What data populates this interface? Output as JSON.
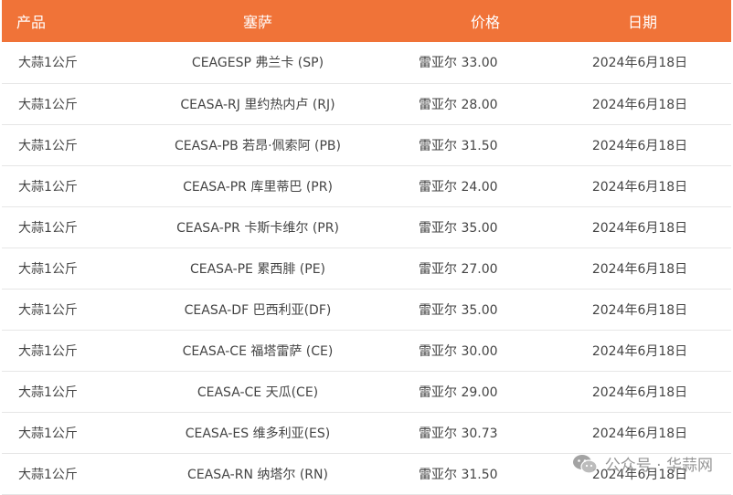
{
  "table": {
    "headers": {
      "product": "产品",
      "ceasa": "塞萨",
      "price": "价格",
      "date": "日期"
    },
    "rows": [
      {
        "product": "大蒜1公斤",
        "ceasa": "CEAGESP 弗兰卡 (SP)",
        "price": "雷亚尔 33.00",
        "date": "2024年6月18日"
      },
      {
        "product": "大蒜1公斤",
        "ceasa": "CEASA-RJ 里约热内卢 (RJ)",
        "price": "雷亚尔 28.00",
        "date": "2024年6月18日"
      },
      {
        "product": "大蒜1公斤",
        "ceasa": "CEASA-PB 若昂·佩索阿 (PB)",
        "price": "雷亚尔 31.50",
        "date": "2024年6月18日"
      },
      {
        "product": "大蒜1公斤",
        "ceasa": "CEASA-PR 库里蒂巴 (PR)",
        "price": "雷亚尔 24.00",
        "date": "2024年6月18日"
      },
      {
        "product": "大蒜1公斤",
        "ceasa": "CEASA-PR 卡斯卡维尔 (PR)",
        "price": "雷亚尔 35.00",
        "date": "2024年6月18日"
      },
      {
        "product": "大蒜1公斤",
        "ceasa": "CEASA-PE 累西腓 (PE)",
        "price": "雷亚尔 27.00",
        "date": "2024年6月18日"
      },
      {
        "product": "大蒜1公斤",
        "ceasa": "CEASA-DF 巴西利亚(DF)",
        "price": "雷亚尔 35.00",
        "date": "2024年6月18日"
      },
      {
        "product": "大蒜1公斤",
        "ceasa": "CEASA-CE 福塔雷萨 (CE)",
        "price": "雷亚尔 30.00",
        "date": "2024年6月18日"
      },
      {
        "product": "大蒜1公斤",
        "ceasa": "CEASA-CE 天瓜(CE)",
        "price": "雷亚尔 29.00",
        "date": "2024年6月18日"
      },
      {
        "product": "大蒜1公斤",
        "ceasa": "CEASA-ES 维多利亚(ES)",
        "price": "雷亚尔 30.73",
        "date": "2024年6月18日"
      },
      {
        "product": "大蒜1公斤",
        "ceasa": "CEASA-RN 纳塔尔 (RN)",
        "price": "雷亚尔 31.50",
        "date": "2024年6月18日"
      }
    ]
  },
  "watermark": {
    "icon": "wechat-icon",
    "text": "公众号 · 华蒜网"
  },
  "colors": {
    "header_bg": "#f07338",
    "header_text": "#ffffff",
    "row_divider": "#e6e6e6",
    "cell_text": "#444444"
  }
}
